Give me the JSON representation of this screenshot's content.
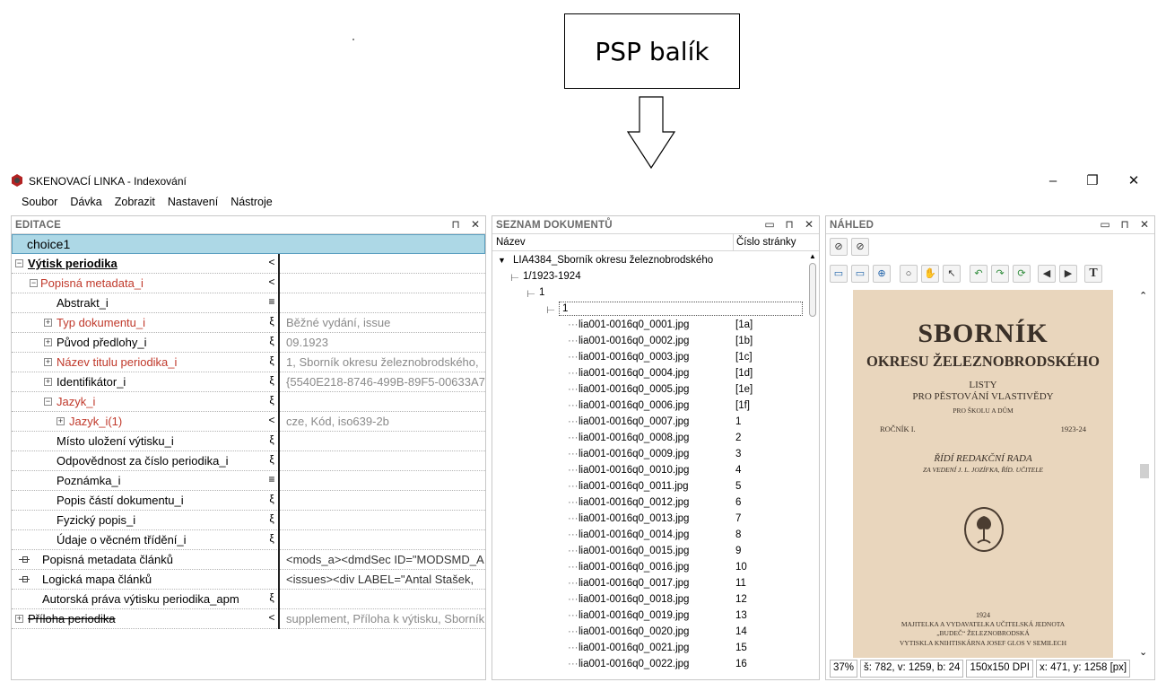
{
  "diagram": {
    "box_label": "PSP balík"
  },
  "window": {
    "title": "SKENOVACÍ LINKA - Indexování",
    "controls": [
      "–",
      "❐",
      "✕"
    ]
  },
  "menu": [
    "Soubor",
    "Dávka",
    "Zobrazit",
    "Nastavení",
    "Nástroje"
  ],
  "editace": {
    "title": "EDITACE",
    "header_icons": [
      "⊓",
      "✕"
    ],
    "choice": "choice1",
    "rows": [
      {
        "name": "Výtisk periodika",
        "marker": "<",
        "value": "",
        "exp": "−",
        "style": "bold"
      },
      {
        "name": "Popisná metadata_i",
        "marker": "<",
        "value": "",
        "exp": "−",
        "style": "red"
      },
      {
        "name": "Abstrakt_i",
        "marker": "≡",
        "value": ""
      },
      {
        "name": "Typ dokumentu_i",
        "marker": "ξ",
        "value": "Běžné vydání, issue",
        "exp": "+",
        "style": "red"
      },
      {
        "name": "Původ předlohy_i",
        "marker": "ξ",
        "value": "09.1923",
        "exp": "+"
      },
      {
        "name": "Název titulu periodika_i",
        "marker": "ξ",
        "value": "1, Sborník okresu železnobrodského,",
        "exp": "+",
        "style": "red"
      },
      {
        "name": "Identifikátor_i",
        "marker": "ξ",
        "value": "{5540E218-8746-499B-89F5-00633A7F",
        "exp": "+"
      },
      {
        "name": "Jazyk_i",
        "marker": "ξ",
        "value": "",
        "exp": "−",
        "style": "red"
      },
      {
        "name": "Jazyk_i(1)",
        "marker": "<",
        "value": "cze, Kód, iso639-2b",
        "exp": "+",
        "style": "red"
      },
      {
        "name": "Místo uložení výtisku_i",
        "marker": "ξ",
        "value": ""
      },
      {
        "name": "Odpovědnost za číslo periodika_i",
        "marker": "ξ",
        "value": ""
      },
      {
        "name": "Poznámka_i",
        "marker": "≡",
        "value": ""
      },
      {
        "name": "Popis částí dokumentu_i",
        "marker": "ξ",
        "value": ""
      },
      {
        "name": "Fyzický popis_i",
        "marker": "ξ",
        "value": ""
      },
      {
        "name": "Údaje o věcném třídění_i",
        "marker": "ξ",
        "value": ""
      },
      {
        "name": "Popisná metadata článků",
        "marker": "",
        "value": "<mods_a><dmdSec ID=\"MODSMD_A",
        "conn": true
      },
      {
        "name": "Logická mapa článků",
        "marker": "",
        "value": "<issues><div LABEL=\"Antal Stašek,",
        "conn": true
      },
      {
        "name": "Autorská práva výtisku periodika_apm",
        "marker": "ξ",
        "value": ""
      },
      {
        "name": "Příloha periodika",
        "marker": "<",
        "value": "supplement, Příloha k výtisku, Sborník",
        "exp": "+",
        "style": "strike"
      }
    ]
  },
  "seznam": {
    "title": "SEZNAM DOKUMENTŮ",
    "header_icons": [
      "▭",
      "⊓",
      "✕"
    ],
    "col_name": "Název",
    "col_page": "Číslo stránky",
    "root": "LIA4384_Sborník okresu železnobrodského",
    "volume": "1/1923-1924",
    "issue": "1",
    "subissue": "1",
    "files": [
      {
        "name": "lia001-0016q0_0001.jpg",
        "page": "[1a]"
      },
      {
        "name": "lia001-0016q0_0002.jpg",
        "page": "[1b]"
      },
      {
        "name": "lia001-0016q0_0003.jpg",
        "page": "[1c]"
      },
      {
        "name": "lia001-0016q0_0004.jpg",
        "page": "[1d]"
      },
      {
        "name": "lia001-0016q0_0005.jpg",
        "page": "[1e]"
      },
      {
        "name": "lia001-0016q0_0006.jpg",
        "page": "[1f]"
      },
      {
        "name": "lia001-0016q0_0007.jpg",
        "page": "1"
      },
      {
        "name": "lia001-0016q0_0008.jpg",
        "page": "2"
      },
      {
        "name": "lia001-0016q0_0009.jpg",
        "page": "3"
      },
      {
        "name": "lia001-0016q0_0010.jpg",
        "page": "4"
      },
      {
        "name": "lia001-0016q0_0011.jpg",
        "page": "5"
      },
      {
        "name": "lia001-0016q0_0012.jpg",
        "page": "6"
      },
      {
        "name": "lia001-0016q0_0013.jpg",
        "page": "7"
      },
      {
        "name": "lia001-0016q0_0014.jpg",
        "page": "8"
      },
      {
        "name": "lia001-0016q0_0015.jpg",
        "page": "9"
      },
      {
        "name": "lia001-0016q0_0016.jpg",
        "page": "10"
      },
      {
        "name": "lia001-0016q0_0017.jpg",
        "page": "11"
      },
      {
        "name": "lia001-0016q0_0018.jpg",
        "page": "12"
      },
      {
        "name": "lia001-0016q0_0019.jpg",
        "page": "13"
      },
      {
        "name": "lia001-0016q0_0020.jpg",
        "page": "14"
      },
      {
        "name": "lia001-0016q0_0021.jpg",
        "page": "15"
      },
      {
        "name": "lia001-0016q0_0022.jpg",
        "page": "16"
      }
    ]
  },
  "nahled": {
    "title": "NÁHLED",
    "header_icons": [
      "▭",
      "⊓",
      "✕"
    ],
    "toolbar1": [
      "paperclip-icon",
      "paperclip-2-icon"
    ],
    "toolbar2": [
      "fit-page-icon",
      "fit-width-icon",
      "zoom-icon",
      "magnifier-icon",
      "hand-icon",
      "pointer-icon",
      "rotate-left-icon",
      "rotate-right-icon",
      "refresh-icon",
      "arrow-left-icon",
      "arrow-right-icon",
      "text-icon"
    ],
    "page": {
      "title": "SBORNÍK",
      "subtitle": "OKRESU ŽELEZNOBRODSKÉHO",
      "listy": "LISTY",
      "pro": "PRO PĚSTOVÁNÍ VLASTIVĚDY",
      "skola": "PRO ŠKOLU A DŮM",
      "rocnik": "ROČNÍK I.",
      "year": "1923-24",
      "ridi": "ŘÍDÍ REDAKČNÍ RADA",
      "vedeni": "ZA VEDENÍ J. L. JOZÍFKA, ŘÍD. UČITELE",
      "foot_year": "1924",
      "foot1": "MAJITELKA A VYDAVATELKA UČITELSKÁ JEDNOTA",
      "foot2": "„BUDEČ“ ŽELEZNOBRODSKÁ",
      "foot3": "VYTISKLA KNIHTISKÁRNA JOSEF GLOS V SEMILECH"
    },
    "status": {
      "zoom": "37%",
      "size": "š: 782, v: 1259, b: 24",
      "dpi": "150x150 DPI",
      "pos": "x: 471, y: 1258 [px]"
    }
  }
}
